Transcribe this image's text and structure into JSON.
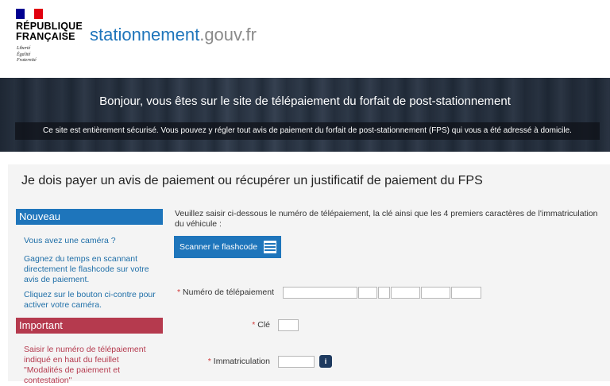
{
  "header": {
    "republique_line1": "RÉPUBLIQUE",
    "republique_line2": "FRANÇAISE",
    "devise_1": "Liberté",
    "devise_2": "Égalité",
    "devise_3": "Fraternité",
    "site_name_part1": "stationnement",
    "site_name_part2": ".gouv.fr",
    "colors": {
      "flag_blue": "#000091",
      "flag_red": "#e1000f",
      "site_blue": "#1e75bb",
      "site_grey": "#8a8a8a"
    }
  },
  "banner": {
    "title": "Bonjour, vous êtes sur le site de télépaiement du forfait de post-stationnement",
    "note": "Ce site est entièrement sécurisé. Vous pouvez y régler tout avis de paiement du forfait de post-stationnement (FPS) qui vous a été adressé à domicile."
  },
  "main": {
    "title": "Je dois payer un avis de paiement ou récupérer un justificatif de paiement du FPS",
    "intro": "Veuillez saisir ci-dessous le numéro de télépaiement, la clé ainsi que les 4 premiers caractères de l'immatriculation du véhicule :",
    "scan_button": "Scanner le flashcode",
    "fields": {
      "numero_label": "Numéro de télépaiement",
      "cle_label": "Clé",
      "immat_label": "Immatriculation",
      "required_mark": "*",
      "info_icon": "i"
    }
  },
  "sidebar": {
    "nouveau": {
      "title": "Nouveau",
      "p1": "Vous avez une caméra ?",
      "p2": "Gagnez du temps en scannant directement le flashcode sur votre avis de paiement.",
      "p3": "Cliquez sur le bouton ci-contre pour activer votre caméra."
    },
    "important": {
      "title": "Important",
      "p1": "Saisir le numéro de télépaiement indiqué en haut du feuillet \"Modalités de paiement et contestation\""
    }
  }
}
